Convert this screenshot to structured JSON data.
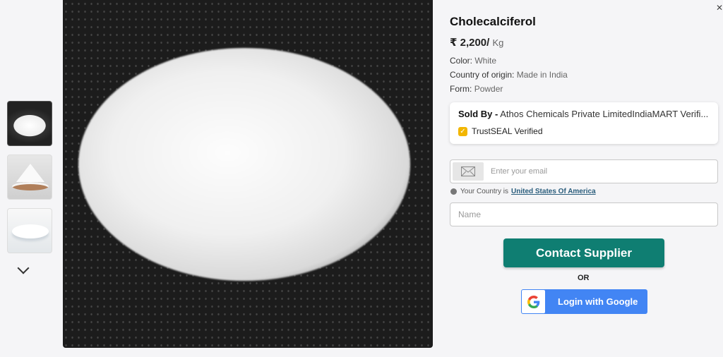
{
  "gallery": {
    "thumbnails": [
      {
        "alt": "powder-pile-dark"
      },
      {
        "alt": "powder-bowl"
      },
      {
        "alt": "powder-plate"
      }
    ],
    "more_icon": "chevron-down-icon"
  },
  "product": {
    "title": "Cholecalciferol",
    "price_currency": "₹",
    "price_value": "2,200/",
    "price_unit": "Kg",
    "specs": [
      {
        "label": "Color:",
        "value": "White"
      },
      {
        "label": "Country of origin:",
        "value": "Made in India"
      },
      {
        "label": "Form:",
        "value": "Powder"
      }
    ]
  },
  "seller": {
    "sold_by_label": "Sold By -",
    "name": "Athos Chemicals Private LimitedIndiaMART Verifi...",
    "trust_label": "TrustSEAL Verified"
  },
  "form": {
    "email_placeholder": "Enter your email",
    "country_prefix": "Your Country is",
    "country_value": "United States Of America",
    "name_placeholder": "Name"
  },
  "actions": {
    "contact_label": "Contact Supplier",
    "or_label": "OR",
    "google_label": "Login with Google"
  },
  "colors": {
    "contact_bg": "#0f7e72",
    "google_bg": "#4285f4",
    "trust_badge": "#f2b600"
  }
}
